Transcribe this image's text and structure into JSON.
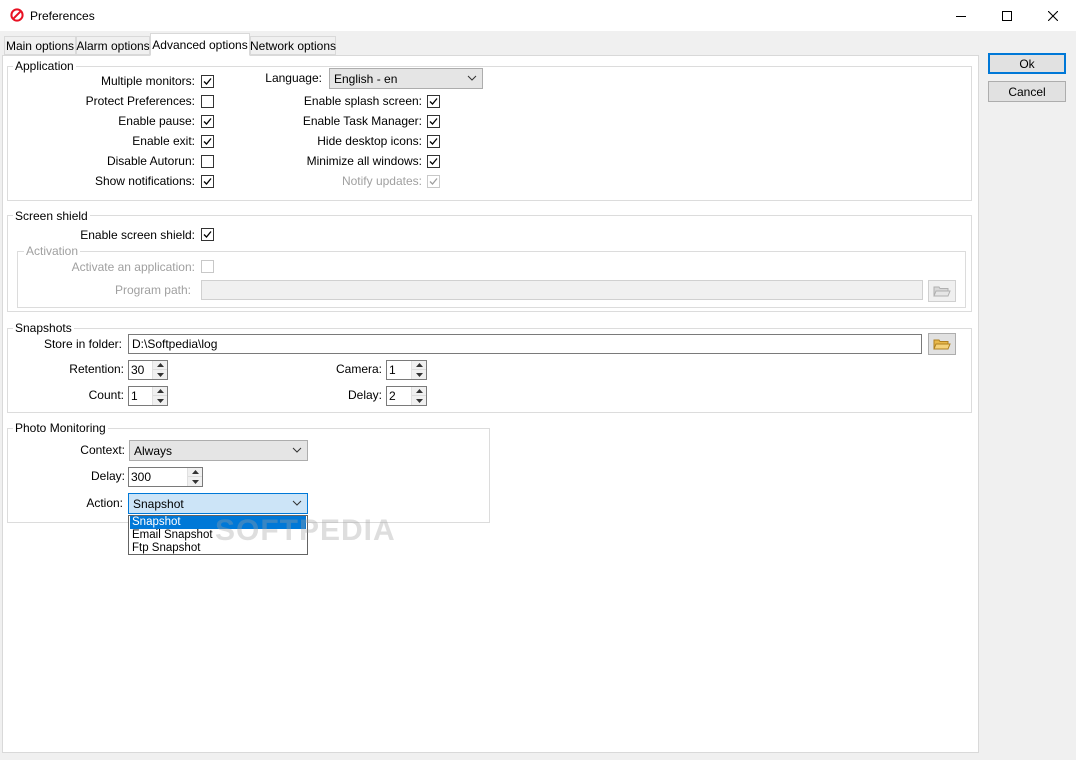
{
  "window": {
    "title": "Preferences",
    "controls": [
      "minimize",
      "maximize",
      "close"
    ]
  },
  "tabs": [
    {
      "label": "Main options",
      "active": false
    },
    {
      "label": "Alarm options",
      "active": false
    },
    {
      "label": "Advanced options",
      "active": true
    },
    {
      "label": "Network options",
      "active": false
    }
  ],
  "buttons": {
    "ok": "Ok",
    "cancel": "Cancel"
  },
  "application": {
    "legend": "Application",
    "left_options": [
      {
        "label": "Multiple monitors:",
        "checked": true
      },
      {
        "label": "Protect Preferences:",
        "checked": false
      },
      {
        "label": "Enable pause:",
        "checked": true
      },
      {
        "label": "Enable exit:",
        "checked": true
      },
      {
        "label": "Disable Autorun:",
        "checked": false
      },
      {
        "label": "Show notifications:",
        "checked": true
      }
    ],
    "language_label": "Language:",
    "language_value": "English - en",
    "right_options": [
      {
        "label": "Enable splash screen:",
        "checked": true,
        "enabled": true
      },
      {
        "label": "Enable Task Manager:",
        "checked": true,
        "enabled": true
      },
      {
        "label": "Hide desktop icons:",
        "checked": true,
        "enabled": true
      },
      {
        "label": "Minimize all windows:",
        "checked": true,
        "enabled": true
      },
      {
        "label": "Notify updates:",
        "checked": true,
        "enabled": false
      }
    ]
  },
  "screen_shield": {
    "legend": "Screen shield",
    "enable_label": "Enable screen shield:",
    "enable_checked": true,
    "activation": {
      "legend": "Activation",
      "activate_label": "Activate an application:",
      "activate_checked": false,
      "program_path_label": "Program path:",
      "program_path_value": ""
    }
  },
  "snapshots": {
    "legend": "Snapshots",
    "folder_label": "Store in folder:",
    "folder_value": "D:\\Softpedia\\log",
    "retention_label": "Retention:",
    "retention_value": "30",
    "count_label": "Count:",
    "count_value": "1",
    "camera_label": "Camera:",
    "camera_value": "1",
    "delay_label": "Delay:",
    "delay_value": "2"
  },
  "photo_monitoring": {
    "legend": "Photo Monitoring",
    "context_label": "Context:",
    "context_value": "Always",
    "delay_label": "Delay:",
    "delay_value": "300",
    "action_label": "Action:",
    "action_value": "Snapshot",
    "action_options": [
      {
        "label": "Snapshot",
        "selected": true
      },
      {
        "label": "Email Snapshot",
        "selected": false
      },
      {
        "label": "Ftp Snapshot",
        "selected": false
      }
    ]
  },
  "watermark": "SOFTPEDIA",
  "colors": {
    "accent": "#0078d7",
    "app_icon": "#e81123"
  }
}
